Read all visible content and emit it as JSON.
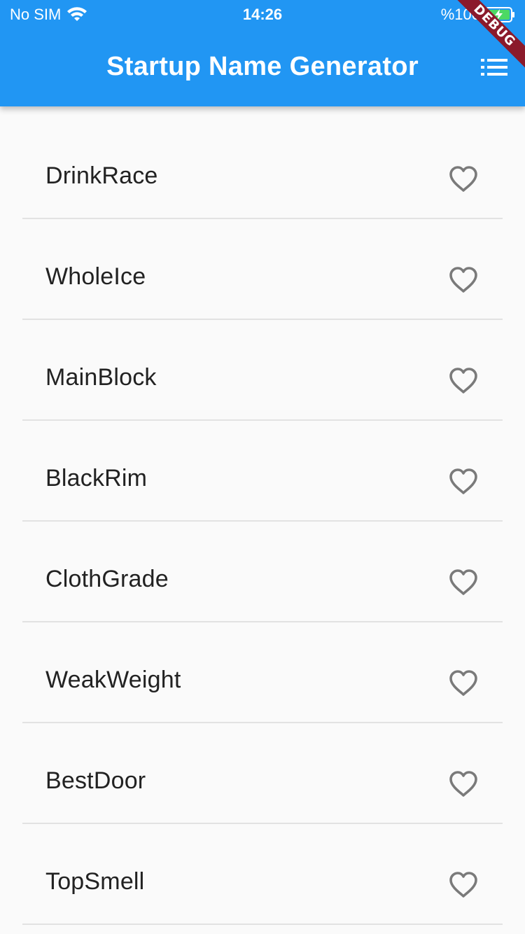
{
  "status_bar": {
    "carrier": "No SIM",
    "time": "14:26",
    "battery": "%100"
  },
  "app_bar": {
    "title": "Startup Name Generator",
    "list_icon": "list-icon",
    "debug_banner": "DEBUG"
  },
  "colors": {
    "primary": "#2196f3",
    "background": "#fafafa",
    "heart_outline": "#7a7a7a",
    "debug": "#8b1a2b",
    "battery_green": "#4cd964"
  },
  "suggestions": [
    {
      "name": "DrinkRace",
      "saved": false
    },
    {
      "name": "WholeIce",
      "saved": false
    },
    {
      "name": "MainBlock",
      "saved": false
    },
    {
      "name": "BlackRim",
      "saved": false
    },
    {
      "name": "ClothGrade",
      "saved": false
    },
    {
      "name": "WeakWeight",
      "saved": false
    },
    {
      "name": "BestDoor",
      "saved": false
    },
    {
      "name": "TopSmell",
      "saved": false
    }
  ]
}
